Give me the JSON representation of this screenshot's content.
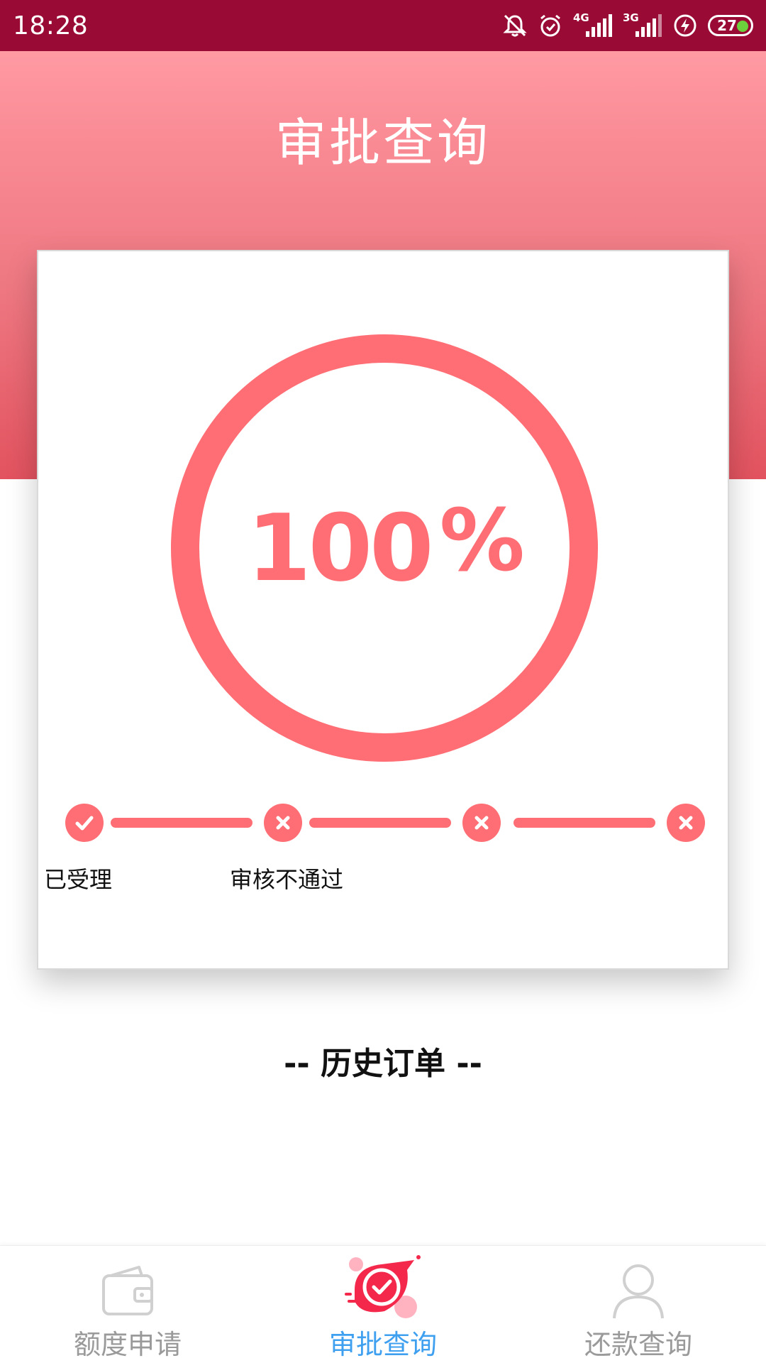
{
  "status_bar": {
    "time": "18:28",
    "network_1": "4G",
    "network_2": "3G",
    "battery": "27",
    "icons": [
      "mute-icon",
      "alarm-icon",
      "signal-4g-icon",
      "signal-3g-icon",
      "charging-icon",
      "battery-icon"
    ]
  },
  "header": {
    "title": "审批查询"
  },
  "progress": {
    "value": "100",
    "percent_sign": "%",
    "fraction": 1.0,
    "color": "#ff6e74"
  },
  "steps": [
    {
      "label": "已受理",
      "status": "done"
    },
    {
      "label": "审核不通过",
      "status": "failed"
    },
    {
      "label": "",
      "status": "failed"
    },
    {
      "label": "",
      "status": "failed"
    }
  ],
  "history": {
    "title": "-- 历史订单 --"
  },
  "bottom_nav": {
    "items": [
      {
        "label": "额度申请",
        "icon": "wallet-icon",
        "active": false
      },
      {
        "label": "审批查询",
        "icon": "approval-check-icon",
        "active": true
      },
      {
        "label": "还款查询",
        "icon": "user-icon",
        "active": false
      }
    ],
    "active_color": "#3fa0f0",
    "inactive_color": "#9a9a9a"
  },
  "colors": {
    "status_bar": "#990b35",
    "accent": "#ff6e74"
  }
}
